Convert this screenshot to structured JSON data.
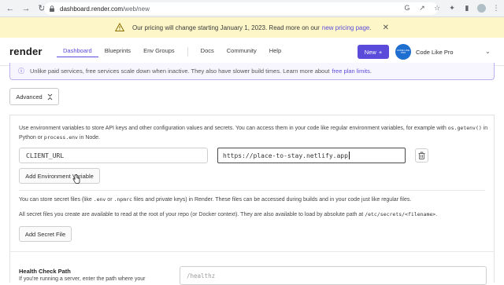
{
  "browser": {
    "url_host": "dashboard.render.com",
    "url_path": "/web/new"
  },
  "banner": {
    "text": "Our pricing will change starting January 1, 2023. Read more on our",
    "link": "new pricing page",
    "suffix": "."
  },
  "header": {
    "logo": "render",
    "nav": [
      "Dashboard",
      "Blueprints",
      "Env Groups",
      "Docs",
      "Community",
      "Help"
    ],
    "new_button": "New",
    "workspace_badge": "CODE LIKE PRO",
    "workspace_name": "Code Like Pro"
  },
  "info_strip": {
    "text": "Unlike paid services, free services scale down when inactive. They also have slower build times. Learn more about",
    "link": "free plan limits",
    "suffix": "."
  },
  "advanced_button": "Advanced",
  "env": {
    "intro_1": "Use environment variables to store API keys and other configuration values and secrets. You can access them in your code like regular environment variables, for example with",
    "code_1": "os.getenv()",
    "intro_2": "in Python or",
    "code_2": "process.env",
    "intro_3": "in Node.",
    "key": "CLIENT_URL",
    "value": "https://place-to-stay.netlify.app",
    "add_button": "Add Environment Variable"
  },
  "secrets": {
    "line1_a": "You can store secret files (like",
    "code_env": ".env",
    "line1_b": "or",
    "code_npmrc": ".npmrc",
    "line1_c": "files and private keys) in Render. These files can be accessed during builds and in your code just like regular files.",
    "line2_a": "All secret files you create are available to read at the root of your repo (or Docker context). They are also available to load by absolute path at",
    "code_path": "/etc/secrets/<filename>",
    "line2_b": ".",
    "add_button": "Add Secret File"
  },
  "health": {
    "title": "Health Check Path",
    "desc": "If you're running a server, enter the path where your",
    "placeholder": "/healthz"
  },
  "colors": {
    "accent": "#5b4bdb",
    "banner_bg": "#fdf6c8"
  }
}
